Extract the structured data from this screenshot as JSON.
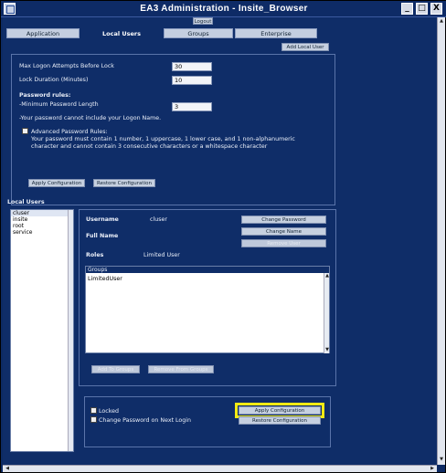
{
  "window": {
    "title": "EA3 Administration - Insite_Browser",
    "minimize_glyph": "_",
    "maximize_glyph": "□",
    "close_glyph": "X"
  },
  "logout_label": "Logout",
  "tabs": [
    {
      "label": "Application",
      "active": false
    },
    {
      "label": "Local Users",
      "active": true
    },
    {
      "label": "Groups",
      "active": false
    },
    {
      "label": "Enterprise",
      "active": false
    }
  ],
  "add_local_user_label": "Add Local User",
  "settings": {
    "max_logon_label": "Max Logon Attempts Before Lock",
    "max_logon_value": "30",
    "lock_duration_label": "Lock Duration (Minutes)",
    "lock_duration_value": "10",
    "password_rules_heading": "Password rules:",
    "min_length_label": "-Minimum Password Length",
    "min_length_value": "3",
    "no_logon_name_rule": "-Your password cannot include your Logon Name.",
    "advanced_rules_label": "Advanced Password Rules:",
    "advanced_rules_line1": "Your password must contain 1 number, 1 uppercase, 1 lower case, and 1 non-alphanumeric",
    "advanced_rules_line2": "character and cannot contain 3 consecutive characters or a whitespace character",
    "apply_label": "Apply Configuration",
    "restore_label": "Restore Configuration"
  },
  "local_users": {
    "heading": "Local Users",
    "items": [
      "cluser",
      "insite",
      "root",
      "service"
    ],
    "selected_index": 0
  },
  "user_detail": {
    "username_label": "Username",
    "username_value": "cluser",
    "fullname_label": "Full Name",
    "roles_label": "Roles",
    "roles_value": "Limited User",
    "change_password_label": "Change Password",
    "change_name_label": "Change Name",
    "remove_user_label": "Remove User",
    "groups_heading": "Groups",
    "groups_items": [
      "LimitedUser"
    ],
    "add_to_groups_label": "Add To Groups",
    "remove_from_groups_label": "Remove From Groups",
    "locked_label": "Locked",
    "change_pw_next_login_label": "Change Password on Next Login",
    "apply_label": "Apply Configuration",
    "restore_label": "Restore Configuration"
  },
  "colors": {
    "background": "#0f2d68",
    "highlight": "#f2ea14"
  }
}
